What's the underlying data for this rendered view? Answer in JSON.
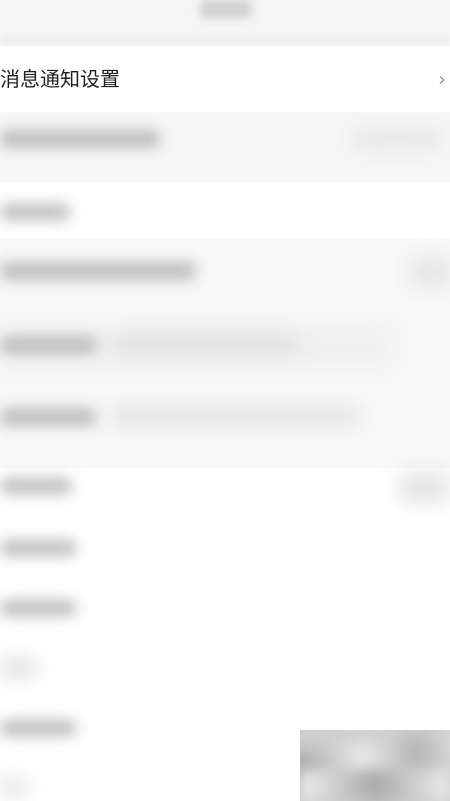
{
  "settings": {
    "notification_row_label": "消息通知设置",
    "chevron_glyph": "›",
    "chevron_icon": "chevron-right-icon"
  }
}
